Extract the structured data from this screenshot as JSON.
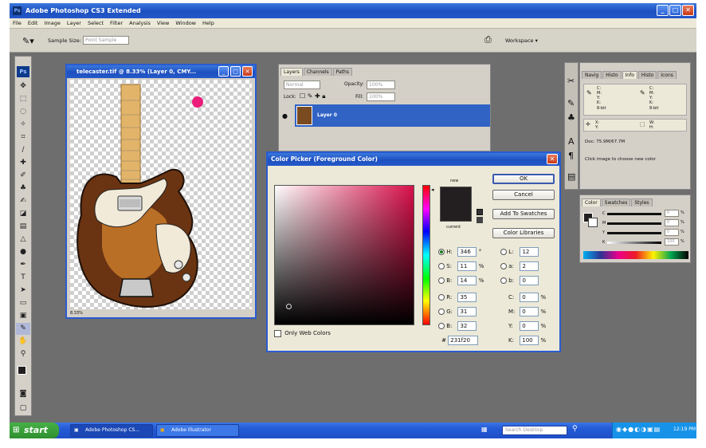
{
  "app": {
    "title": "Adobe Photoshop CS3 Extended"
  },
  "menu": [
    "File",
    "Edit",
    "Image",
    "Layer",
    "Select",
    "Filter",
    "Analysis",
    "View",
    "Window",
    "Help"
  ],
  "options": {
    "sample_size_label": "Sample Size:",
    "sample_size_value": "Point Sample",
    "workspace_label": "Workspace"
  },
  "toolbox": {
    "logo": "Ps"
  },
  "document": {
    "title": "telecaster.tif @ 8.33% (Layer 0, CMY...",
    "zoom": "8.33%"
  },
  "layers": {
    "tabs": [
      "Layers",
      "Channels",
      "Paths"
    ],
    "blend_mode": "Normal",
    "opacity_label": "Opacity:",
    "opacity_value": "100%",
    "lock_label": "Lock:",
    "fill_label": "Fill:",
    "fill_value": "100%",
    "layer_name": "Layer 0"
  },
  "info_panel": {
    "tabs": [
      "Navig",
      "Histo",
      "Info",
      "Histo",
      "Icons"
    ],
    "c_label": "C:",
    "m_label": "M:",
    "y_label": "Y:",
    "k_label": "K:",
    "bit_label": "8-bit",
    "x_label": "X:",
    "y_coord_label": "Y:",
    "w_label": "W:",
    "h_label": "H:",
    "doc_size": "Doc: 75.9M/67.7M",
    "hint": "Click image to choose new color"
  },
  "color_panel": {
    "tabs": [
      "Color",
      "Swatches",
      "Styles"
    ],
    "c": "C",
    "m": "M",
    "y": "Y",
    "k": "K",
    "c_val": "0",
    "m_val": "0",
    "y_val": "0",
    "k_val": "100",
    "pct": "%"
  },
  "color_picker": {
    "title": "Color Picker (Foreground Color)",
    "new_label": "new",
    "current_label": "current",
    "ok": "OK",
    "cancel": "Cancel",
    "add_to_swatches": "Add To Swatches",
    "color_libraries": "Color Libraries",
    "h_label": "H:",
    "h_val": "346",
    "h_unit": "°",
    "s_label": "S:",
    "s_val": "11",
    "s_unit": "%",
    "b_label": "B:",
    "b_val": "14",
    "b_unit": "%",
    "r_label": "R:",
    "r_val": "35",
    "g_label": "G:",
    "g_val": "31",
    "bb_label": "B:",
    "bb_val": "32",
    "l_label": "L:",
    "l_val": "12",
    "a_label": "a:",
    "a_val": "2",
    "b2_label": "b:",
    "b2_val": "0",
    "c_label": "C:",
    "c_val": "0",
    "c_unit": "%",
    "m_label": "M:",
    "m_val": "0",
    "m_unit": "%",
    "y_label": "Y:",
    "y_val": "0",
    "y_unit": "%",
    "k_label": "K:",
    "k_val": "100",
    "k_unit": "%",
    "hex_label": "#",
    "hex_val": "231f20",
    "only_web": "Only Web Colors"
  },
  "taskbar": {
    "start": "start",
    "tasks": [
      "Adobe Photoshop CS...",
      "Adobe Illustrator"
    ],
    "search_placeholder": "Search Desktop",
    "clock": "12:19 PM"
  },
  "colors": {
    "picked": "#231f20",
    "xp_blue": "#2459c8",
    "layer_selected": "#3163c5"
  }
}
